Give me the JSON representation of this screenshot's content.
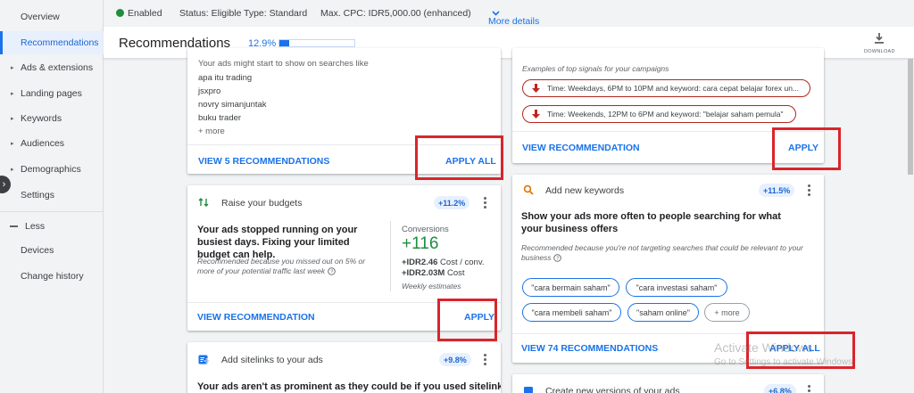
{
  "sidebar": {
    "items": [
      {
        "label": "Overview",
        "has_caret": false,
        "active": false
      },
      {
        "label": "Recommendations",
        "has_caret": false,
        "active": true
      },
      {
        "label": "Ads & extensions",
        "has_caret": true,
        "active": false
      },
      {
        "label": "Landing pages",
        "has_caret": true,
        "active": false
      },
      {
        "label": "Keywords",
        "has_caret": true,
        "active": false
      },
      {
        "label": "Audiences",
        "has_caret": true,
        "active": false
      },
      {
        "label": "Demographics",
        "has_caret": true,
        "active": false
      },
      {
        "label": "Settings",
        "has_caret": false,
        "active": false
      }
    ],
    "less_label": "Less",
    "extra_items": [
      {
        "label": "Devices"
      },
      {
        "label": "Change history"
      }
    ]
  },
  "status_bar": {
    "status": "Enabled",
    "status_field": "Status: Eligible",
    "type_field": "Type: Standard",
    "max_cpc_field": "Max. CPC: IDR5,000.00 (enhanced)",
    "more_details": "More details"
  },
  "header": {
    "title": "Recommendations",
    "optimization_score": "12.9%",
    "optimization_fraction": 0.129,
    "download_label": "DOWNLOAD"
  },
  "cards": {
    "keywords_preview": {
      "intro": "Your ads might start to show on searches like",
      "searches": [
        "apa itu trading",
        "jsxpro",
        "novry simanjuntak",
        "buku trader"
      ],
      "more": "+ more",
      "view_link": "VIEW 5 RECOMMENDATIONS",
      "apply_link": "APPLY ALL"
    },
    "signals": {
      "intro": "Examples of top signals for your campaigns",
      "chips": [
        "Time: Weekdays, 6PM to 10PM and keyword: cara cepat belajar forex un...",
        "Time: Weekends, 12PM to 6PM and keyword: \"belajar saham pemula\""
      ],
      "view_link": "VIEW RECOMMENDATION",
      "apply_link": "APPLY"
    },
    "budgets": {
      "title": "Raise your budgets",
      "badge": "+11.2%",
      "headline": "Your ads stopped running on your busiest days. Fixing your limited budget can help.",
      "note": "Recommended because you missed out on 5% or more of your potential traffic last week",
      "metric_label": "Conversions",
      "metric_value": "+116",
      "cost_per_conv_value": "+IDR2.46",
      "cost_per_conv_unit": "Cost / conv.",
      "cost_value": "+IDR2.03M",
      "cost_unit": "Cost",
      "estimates": "Weekly estimates",
      "view_link": "VIEW RECOMMENDATION",
      "apply_link": "APPLY"
    },
    "new_keywords": {
      "title": "Add new keywords",
      "badge": "+11.5%",
      "headline": "Show your ads more often to people searching for what your business offers",
      "note": "Recommended because you're not targeting searches that could be relevant to your business",
      "chips": [
        "\"cara bermain saham\"",
        "\"cara investasi saham\"",
        "\"cara membeli saham\"",
        "\"saham online\""
      ],
      "more_chip": "+ more",
      "view_link": "VIEW 74 RECOMMENDATIONS",
      "apply_link": "APPLY ALL"
    },
    "sitelinks": {
      "title": "Add sitelinks to your ads",
      "badge": "+9.8%",
      "headline": "Your ads aren't as prominent as they could be if you used sitelinks,"
    },
    "new_versions": {
      "title": "Create new versions of your ads",
      "badge": "+6.8%"
    }
  },
  "watermark": {
    "line1": "Activate Windows",
    "line2": "Go to Settings to activate Windows."
  },
  "colors": {
    "accent": "#1a73e8",
    "enabled": "#1e8e3e",
    "highlight_box": "#d9252c",
    "signal_border": "#b3261e"
  }
}
